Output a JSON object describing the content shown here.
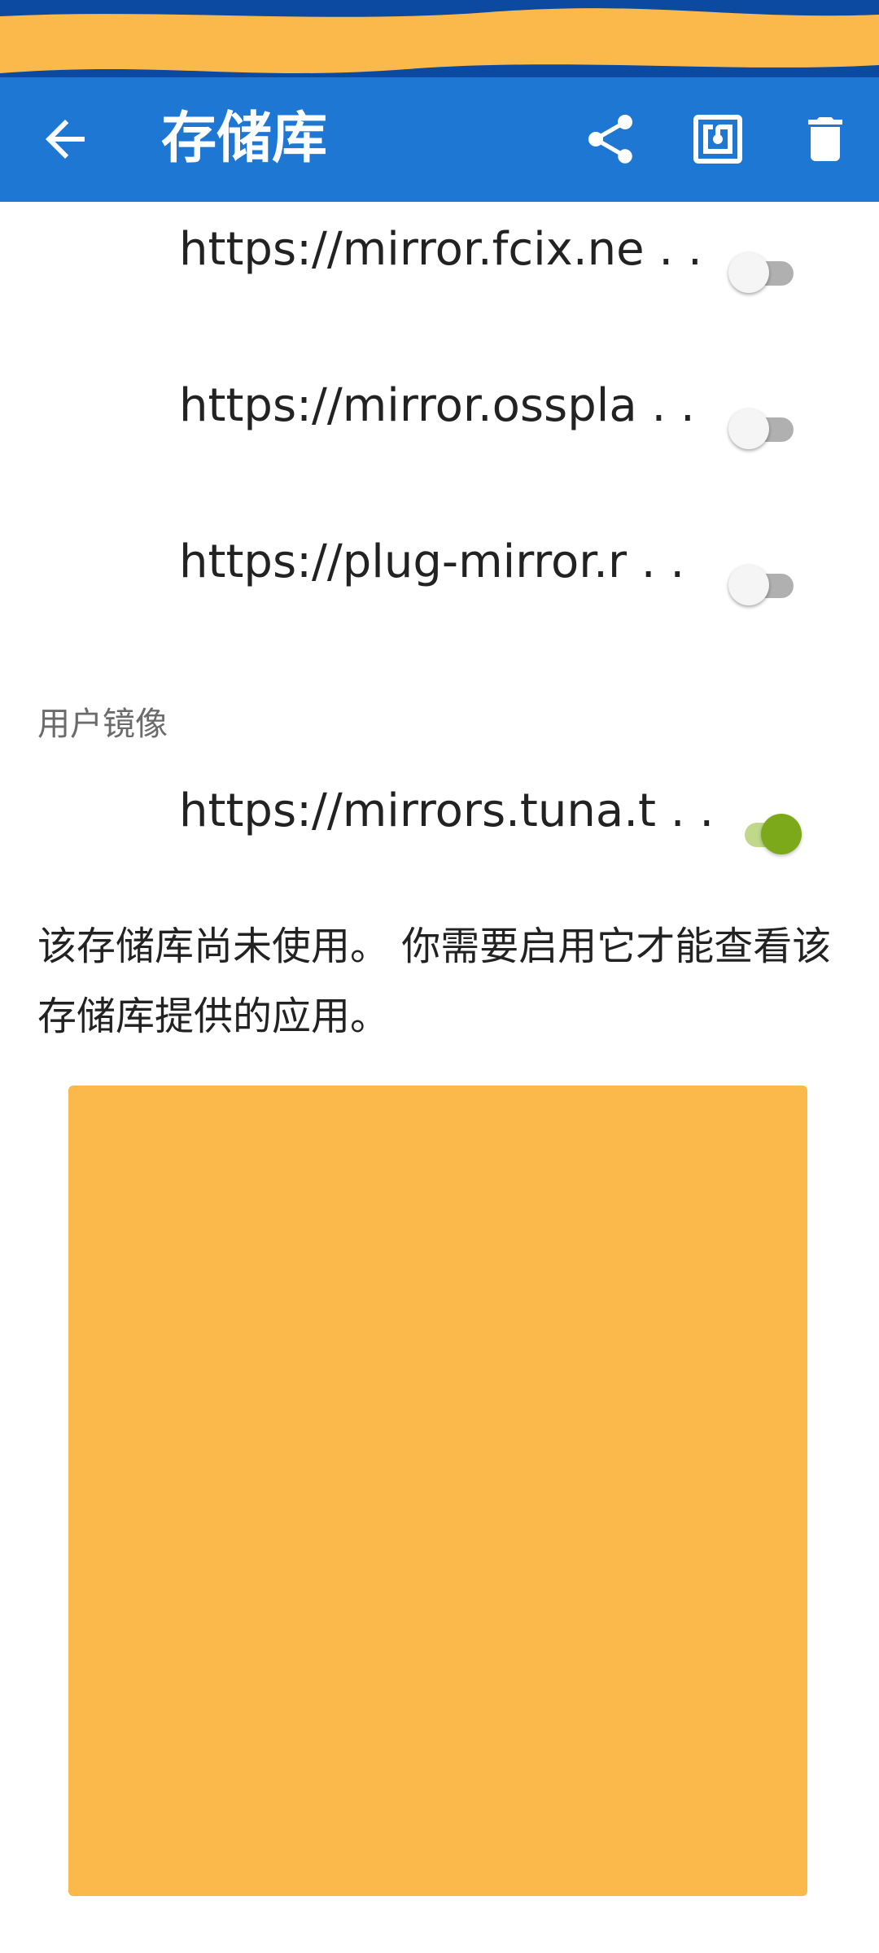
{
  "app_bar": {
    "title": "存储库",
    "icons": [
      "arrow-back-icon",
      "share-icon",
      "nfc-icon",
      "delete-icon"
    ]
  },
  "mirrors": [
    {
      "url": "https://mirror.fcix.ne . .",
      "enabled": false
    },
    {
      "url": "https://mirror.osspla . .",
      "enabled": false
    },
    {
      "url": "https://plug-mirror.r . .",
      "enabled": false
    }
  ],
  "user_mirrors": {
    "header": "用户镜像",
    "items": [
      {
        "url": "https://mirrors.tuna.t . .",
        "enabled": true
      }
    ]
  },
  "notice": "该存储库尚未使用。 你需要启用它才能查看该存储库提供的应用。",
  "colors": {
    "app_bar": "#1e77d3",
    "switch_on": "#7ba919",
    "redaction": "#fbb94c"
  }
}
